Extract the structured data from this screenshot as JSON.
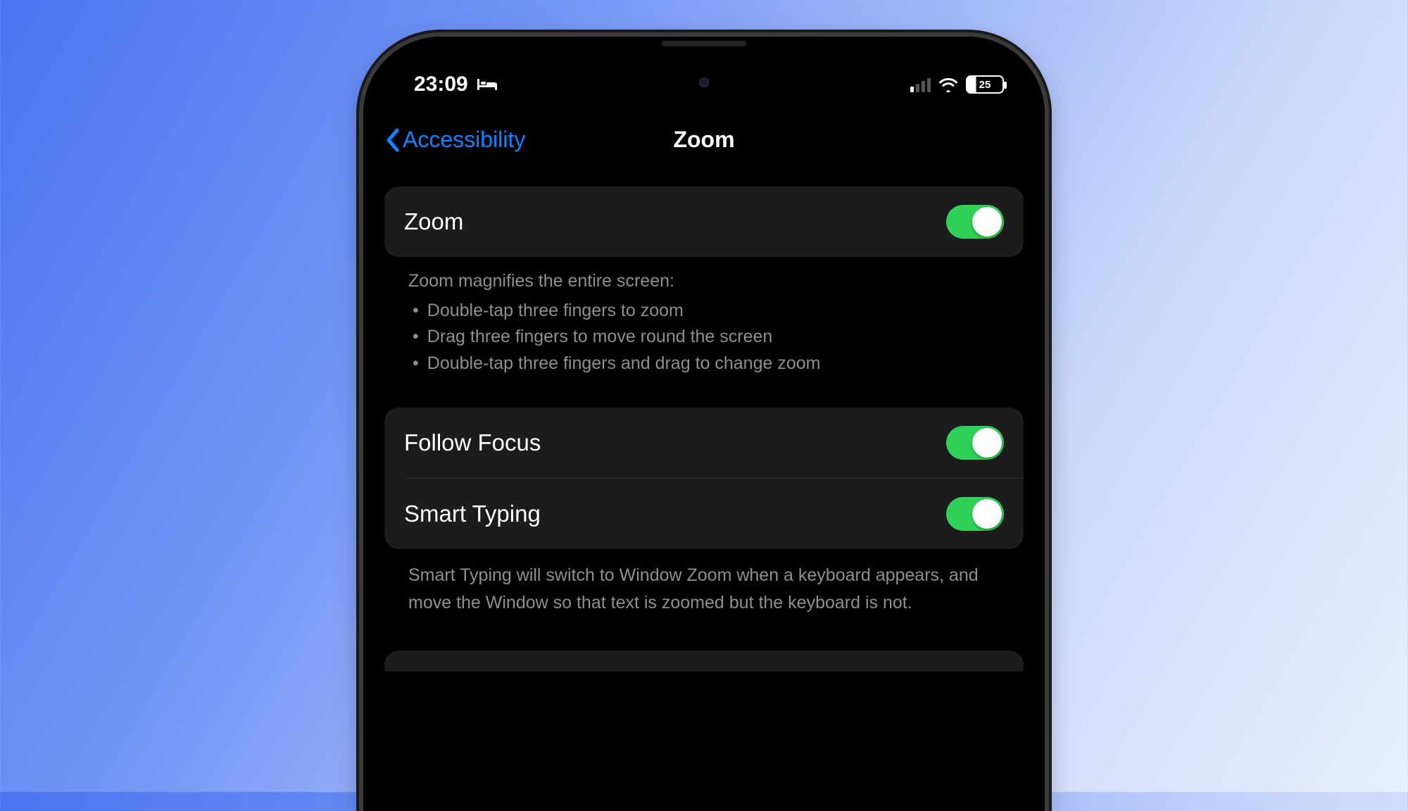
{
  "status": {
    "time": "23:09",
    "battery_percent": "25"
  },
  "nav": {
    "back_label": "Accessibility",
    "title": "Zoom"
  },
  "group1": {
    "zoom_label": "Zoom",
    "footer_heading": "Zoom magnifies the entire screen:",
    "bullets": {
      "b0": "Double-tap three fingers to zoom",
      "b1": "Drag three fingers to move round the screen",
      "b2": "Double-tap three fingers and drag to change zoom"
    }
  },
  "group2": {
    "follow_focus_label": "Follow Focus",
    "smart_typing_label": "Smart Typing",
    "footer": "Smart Typing will switch to Window Zoom when a keyboard appears, and move the Window so that text is zoomed but the keyboard is not."
  }
}
